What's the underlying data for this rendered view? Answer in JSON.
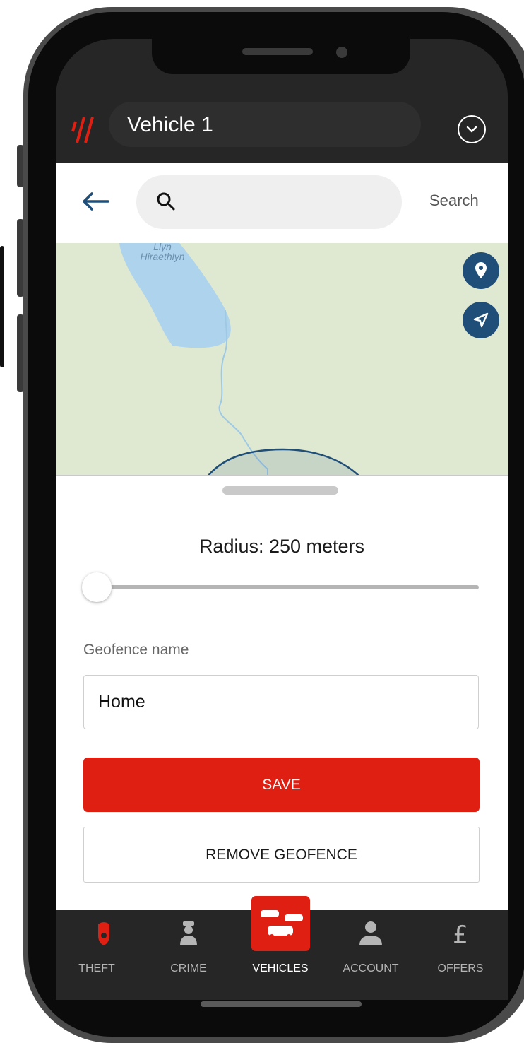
{
  "header": {
    "vehicle_name": "Vehicle 1"
  },
  "search": {
    "value": "",
    "button_label": "Search"
  },
  "map": {
    "lake_label_line1": "Llyn",
    "lake_label_line2": "Hiraethlyn"
  },
  "geofence": {
    "radius_label": "Radius: 250 meters",
    "radius_value": 250,
    "slider_fraction": 0.0,
    "name_label": "Geofence name",
    "name_value": "Home",
    "save_label": "SAVE",
    "remove_label": "REMOVE GEOFENCE"
  },
  "tabs": [
    {
      "label": "THEFT",
      "icon": "police-badge-icon",
      "color": "#e01f13"
    },
    {
      "label": "CRIME",
      "icon": "police-officer-icon",
      "color": "#b5b5b5"
    },
    {
      "label": "VEHICLES",
      "icon": "cars-icon",
      "active": true,
      "color": "#ffffff"
    },
    {
      "label": "ACCOUNT",
      "icon": "person-icon",
      "color": "#b5b5b5"
    },
    {
      "label": "OFFERS",
      "icon": "pound-icon",
      "color": "#b5b5b5"
    }
  ],
  "colors": {
    "brand_red": "#e01f13",
    "map_button_blue": "#1f4e79",
    "dark_bar": "#262626"
  }
}
